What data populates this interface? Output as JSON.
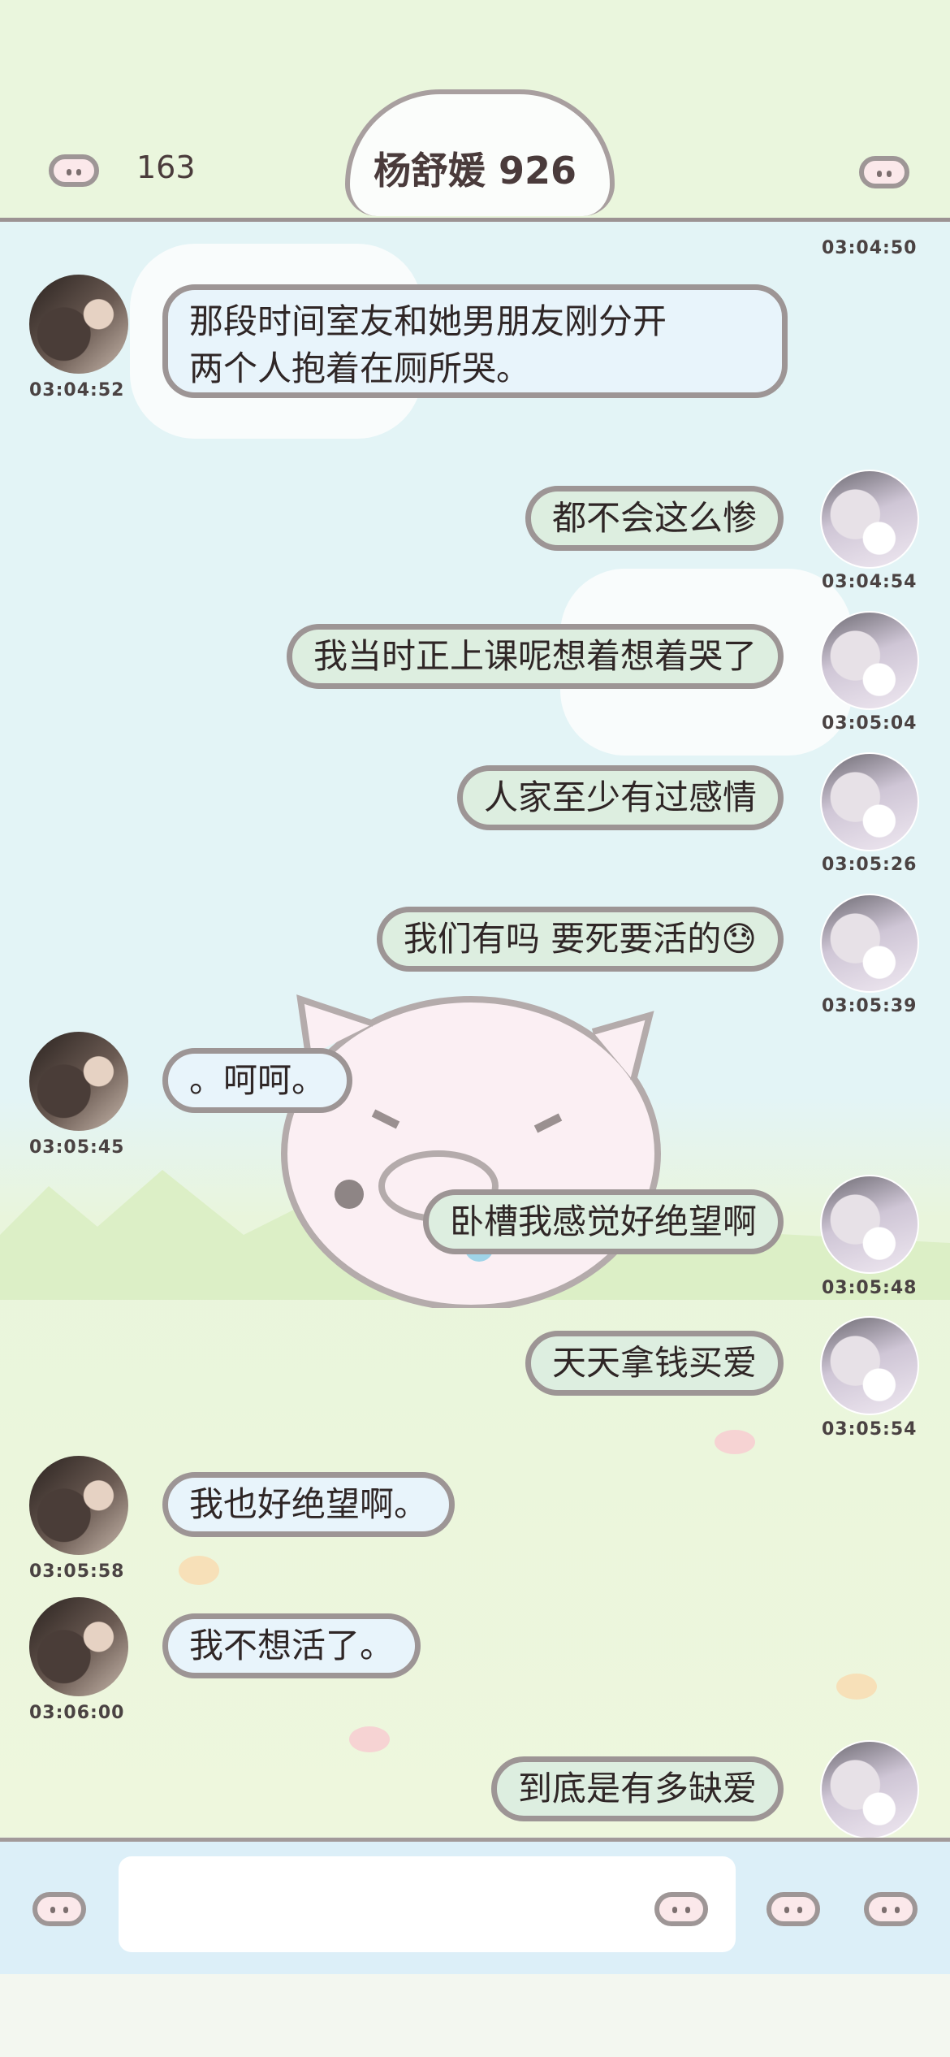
{
  "header": {
    "title": "杨舒媛 926",
    "count": "163",
    "back_icon": "pig-nose-icon",
    "menu_icon": "pig-nose-icon"
  },
  "messages": [
    {
      "side": "right",
      "time": "03:04:50"
    },
    {
      "side": "left",
      "text": "那段时间室友和她男朋友刚分开",
      "text2": "两个人抱着在厕所哭。",
      "time": "03:04:52"
    },
    {
      "side": "right",
      "text": "都不会这么惨",
      "time": "03:04:54"
    },
    {
      "side": "right",
      "text": "我当时正上课呢想着想着哭了",
      "time": "03:05:04"
    },
    {
      "side": "right",
      "text": "人家至少有过感情",
      "time": "03:05:26"
    },
    {
      "side": "right",
      "text": "我们有吗 要死要活的😓",
      "time": "03:05:39"
    },
    {
      "side": "left",
      "text": "。呵呵。",
      "time": "03:05:45"
    },
    {
      "side": "right",
      "text": "卧槽我感觉好绝望啊",
      "time": "03:05:48"
    },
    {
      "side": "right",
      "text": "天天拿钱买爱",
      "time": "03:05:54"
    },
    {
      "side": "left",
      "text": "我也好绝望啊。",
      "time": "03:05:58"
    },
    {
      "side": "left",
      "text": "我不想活了。",
      "time": "03:06:00"
    },
    {
      "side": "right",
      "text": "到底是有多缺爱"
    }
  ],
  "input": {
    "placeholder": ""
  },
  "colors": {
    "bubble_out": "#ddeee0",
    "bubble_in": "#e8f4fb",
    "border": "#9d9595",
    "header_bg": "#eaf6dd"
  }
}
